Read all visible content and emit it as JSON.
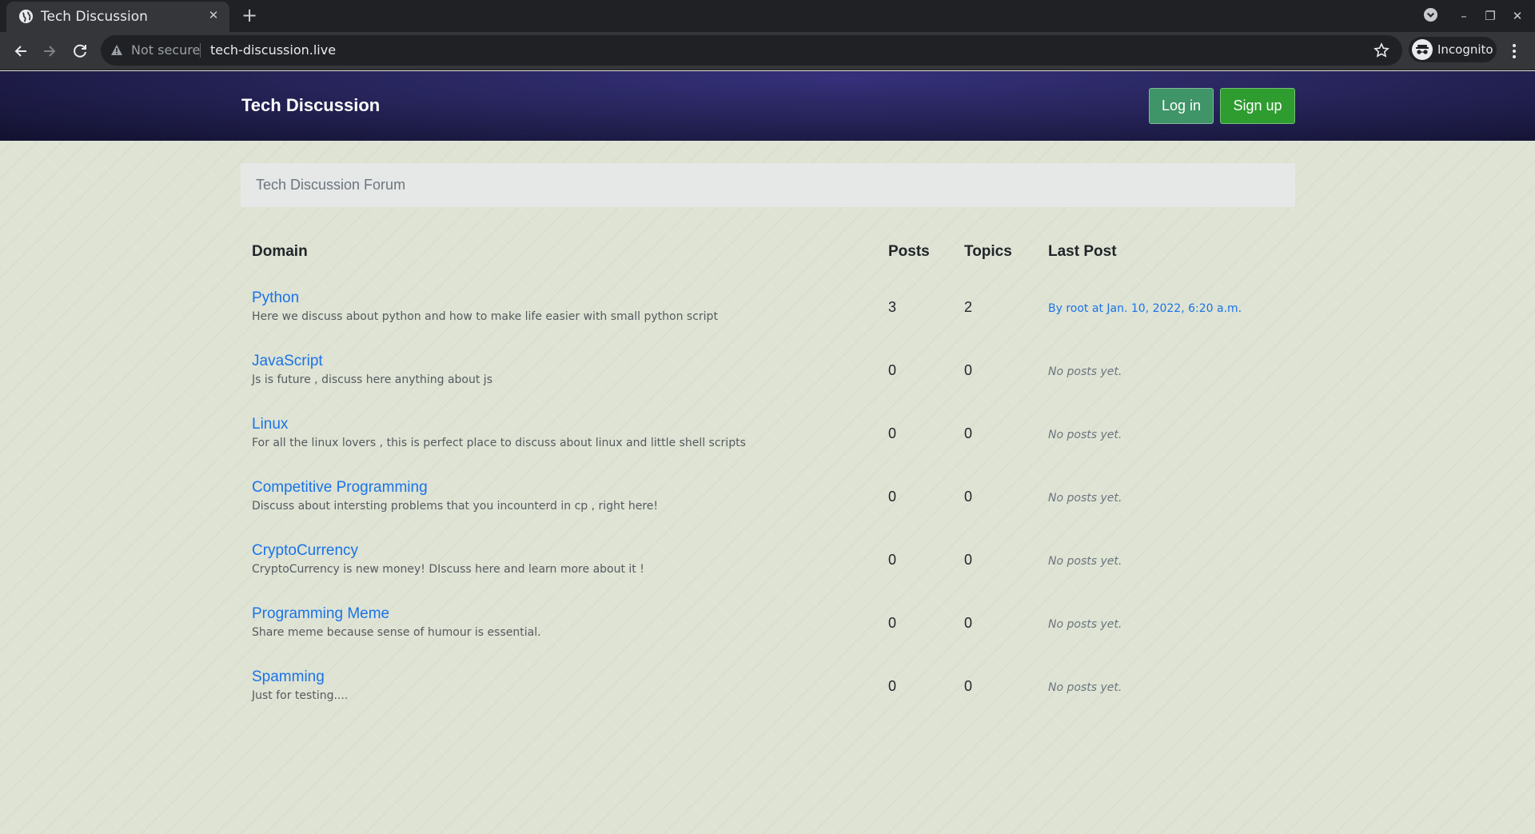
{
  "browser": {
    "tab_title": "Tech Discussion",
    "tab_close": "✕",
    "new_tab": "+",
    "not_secure": "Not secure",
    "url": "tech-discussion.live",
    "incognito_label": "Incognito",
    "window_controls": {
      "minimize": "–",
      "restore": "❐",
      "close": "✕"
    }
  },
  "header": {
    "brand": "Tech Discussion",
    "login_label": "Log in",
    "signup_label": "Sign up"
  },
  "forum_bar": {
    "title": "Tech Discussion Forum"
  },
  "table": {
    "headers": {
      "domain": "Domain",
      "posts": "Posts",
      "topics": "Topics",
      "last_post": "Last Post"
    },
    "rows": [
      {
        "name": "Python",
        "description": "Here we discuss about python and how to make life easier with small python script",
        "posts": "3",
        "topics": "2",
        "last_post": "By root at Jan. 10, 2022, 6:20 a.m."
      },
      {
        "name": "JavaScript",
        "description": "Js is future , discuss here anything about js",
        "posts": "0",
        "topics": "0",
        "last_post": "No posts yet."
      },
      {
        "name": "Linux",
        "description": "For all the linux lovers , this is perfect place to discuss about linux and little shell scripts",
        "posts": "0",
        "topics": "0",
        "last_post": "No posts yet."
      },
      {
        "name": "Competitive Programming",
        "description": "Discuss about intersting problems that you incounterd in cp , right here!",
        "posts": "0",
        "topics": "0",
        "last_post": "No posts yet."
      },
      {
        "name": "CryptoCurrency",
        "description": "CryptoCurrency is new money! DIscuss here and learn more about it !",
        "posts": "0",
        "topics": "0",
        "last_post": "No posts yet."
      },
      {
        "name": "Programming Meme",
        "description": "Share meme because sense of humour is essential.",
        "posts": "0",
        "topics": "0",
        "last_post": "No posts yet."
      },
      {
        "name": "Spamming",
        "description": "Just for testing....",
        "posts": "0",
        "topics": "0",
        "last_post": "No posts yet."
      }
    ]
  }
}
